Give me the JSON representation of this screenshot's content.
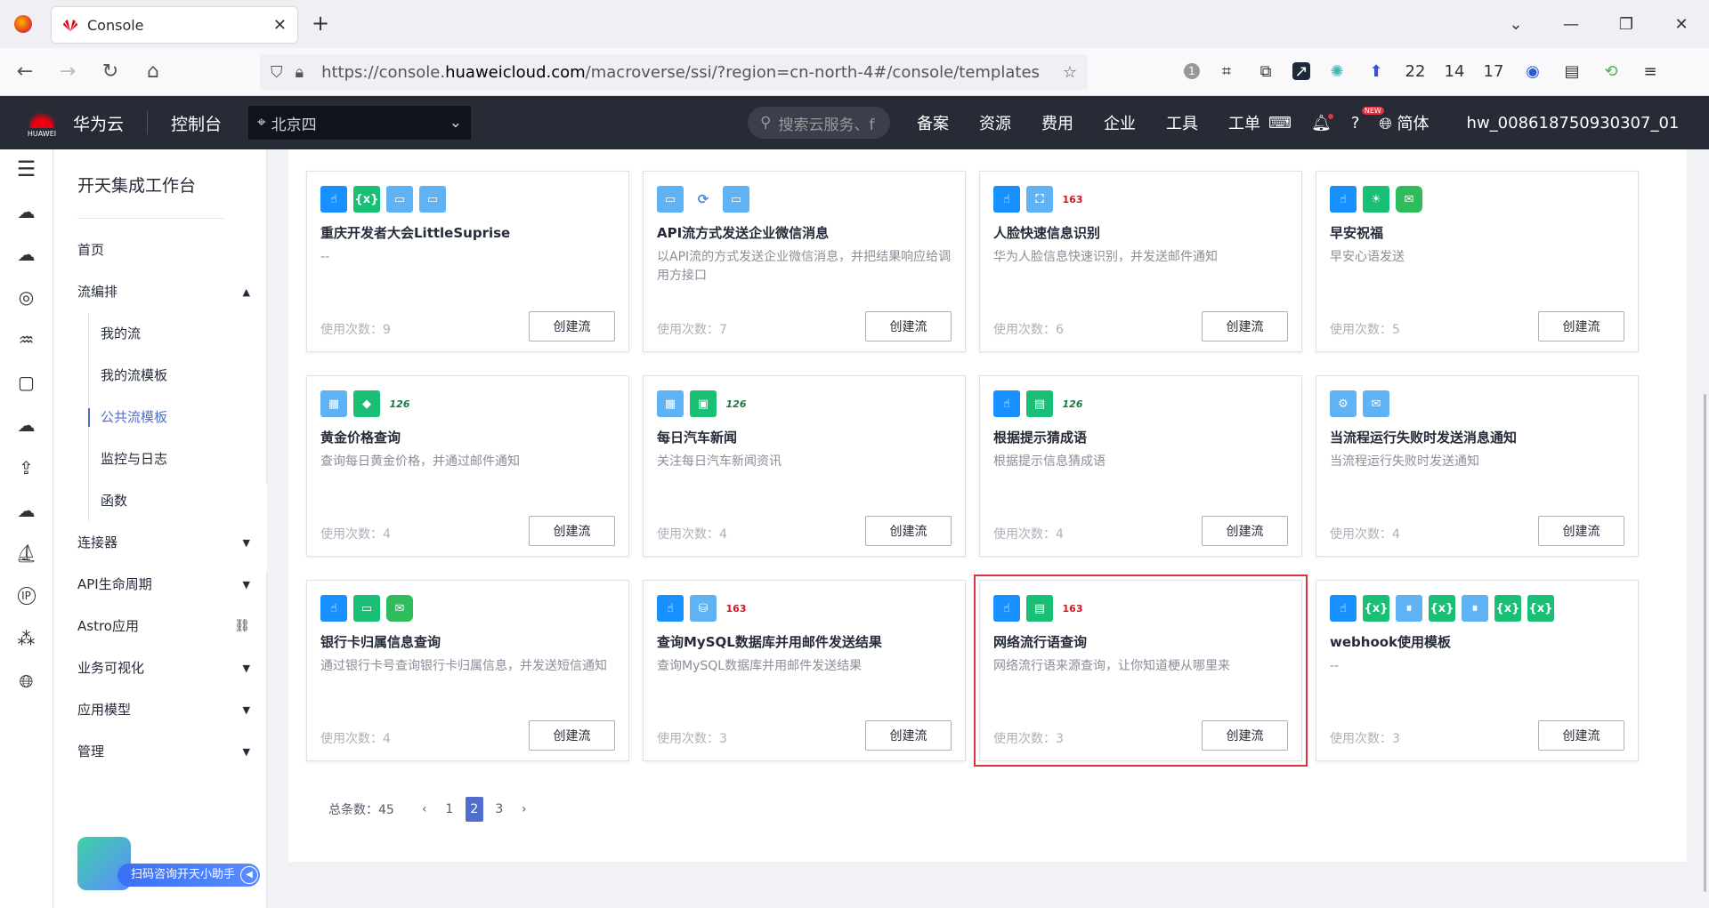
{
  "browser": {
    "tab_title": "Console",
    "url_prefix": "https://console.",
    "url_domain": "huaweicloud.com",
    "url_path": "/macroverse/ssi/?region=cn-north-4#/console/templates",
    "ext_counts": [
      "22",
      "14",
      "17"
    ],
    "ext_badge": "1"
  },
  "topnav": {
    "logo_text": "HUAWEI",
    "brand": "华为云",
    "console": "控制台",
    "region": "北京四",
    "search_placeholder": "搜索云服务、f",
    "menu": [
      "备案",
      "资源",
      "费用",
      "企业",
      "工具",
      "工单"
    ],
    "new_badge": "NEW",
    "lang": "简体",
    "user": "hw_008618750930307_01"
  },
  "sidebar": {
    "title": "开天集成工作台",
    "home": "首页",
    "flow": "流编排",
    "sub": [
      "我的流",
      "我的流模板",
      "公共流模板",
      "监控与日志",
      "函数"
    ],
    "connector": "连接器",
    "api": "API生命周期",
    "astro": "Astro应用",
    "viz": "业务可视化",
    "model": "应用模型",
    "manage": "管理",
    "assistant": "扫码咨询开天小助手"
  },
  "cards": [
    {
      "title": "重庆开发者大会LittleSuprise",
      "desc": "--",
      "usage": "使用次数：9",
      "btn": "创建流",
      "icons": [
        "blue:hand",
        "green:{x}",
        "lightblue:http",
        "lightblue:http"
      ]
    },
    {
      "title": "API流方式发送企业微信消息",
      "desc": "以API流的方式发送企业微信消息，并把结果响应给调用方接口",
      "usage": "使用次数：7",
      "btn": "创建流",
      "icons": [
        "lightblue:api",
        "plain:wx",
        "lightblue:api"
      ]
    },
    {
      "title": "人脸快速信息识别",
      "desc": "华为人脸信息快速识别，并发送邮件通知",
      "usage": "使用次数：6",
      "btn": "创建流",
      "icons": [
        "blue:hand",
        "lightblue:face",
        "n163:163"
      ]
    },
    {
      "title": "早安祝福",
      "desc": "早安心语发送",
      "usage": "使用次数：5",
      "btn": "创建流",
      "icons": [
        "blue:hand",
        "green:sun",
        "wechat:msg"
      ]
    },
    {
      "title": "黄金价格查询",
      "desc": "查询每日黄金价格，并通过邮件通知",
      "usage": "使用次数：4",
      "btn": "创建流",
      "icons": [
        "lightblue:cal",
        "green:gold",
        "n126:126"
      ]
    },
    {
      "title": "每日汽车新闻",
      "desc": "关注每日汽车新闻资讯",
      "usage": "使用次数：4",
      "btn": "创建流",
      "icons": [
        "lightblue:cal",
        "green:car",
        "n126:126"
      ]
    },
    {
      "title": "根据提示猜成语",
      "desc": "根据提示信息猜成语",
      "usage": "使用次数：4",
      "btn": "创建流",
      "icons": [
        "blue:hand",
        "green:doc",
        "n126:126"
      ]
    },
    {
      "title": "当流程运行失败时发送消息通知",
      "desc": "当流程运行失败时发送通知",
      "usage": "使用次数：4",
      "btn": "创建流",
      "icons": [
        "lightblue:gear",
        "lightblue:msg"
      ]
    },
    {
      "title": "银行卡归属信息查询",
      "desc": "通过银行卡号查询银行卡归属信息，并发送短信通知",
      "usage": "使用次数：4",
      "btn": "创建流",
      "icons": [
        "blue:hand",
        "green:card",
        "wechat:msg"
      ]
    },
    {
      "title": "查询MySQL数据库并用邮件发送结果",
      "desc": "查询MySQL数据库并用邮件发送结果",
      "usage": "使用次数：3",
      "btn": "创建流",
      "icons": [
        "blue:hand",
        "lightblue:db",
        "n163:163"
      ]
    },
    {
      "title": "网络流行语查询",
      "desc": "网络流行语来源查询，让你知道梗从哪里来",
      "usage": "使用次数：3",
      "btn": "创建流",
      "icons": [
        "blue:hand",
        "green:doc",
        "n163:163"
      ]
    },
    {
      "title": "webhook使用模板",
      "desc": "--",
      "usage": "使用次数：3",
      "btn": "创建流",
      "icons": [
        "blue:hand",
        "green:{x}",
        "lightblue:pause",
        "green:{x}",
        "lightblue:pause",
        "green:{x}",
        "green:{x}"
      ]
    }
  ],
  "highlighted_card": "网络流行语查询",
  "pager": {
    "total": "总条数：45",
    "pages": [
      "1",
      "2",
      "3"
    ],
    "current": "2"
  }
}
